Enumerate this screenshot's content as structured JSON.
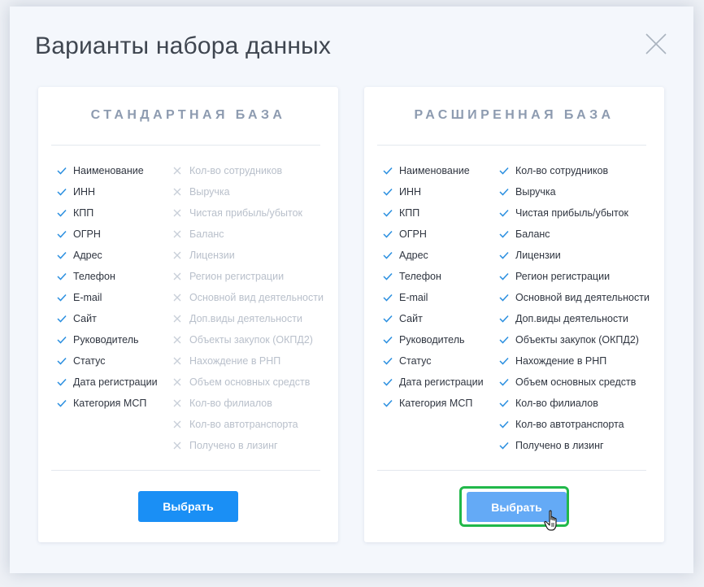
{
  "modal": {
    "title": "Варианты набора данных",
    "close_icon": "close-icon"
  },
  "cards": [
    {
      "title": "СТАНДАРТНАЯ БАЗА",
      "button_label": "Выбрать",
      "button_color": "#1a8ff5",
      "col1": [
        "Наименование",
        "ИНН",
        "КПП",
        "ОГРН",
        "Адрес",
        "Телефон",
        "E-mail",
        "Сайт",
        "Руководитель",
        "Статус",
        "Дата регистрации",
        "Категория МСП"
      ],
      "col2": [
        "Кол-во сотрудников",
        "Выручка",
        "Чистая прибыль/убыток",
        "Баланс",
        "Лицензии",
        "Регион регистрации",
        "Основной вид деятельности",
        "Доп.виды деятельности",
        "Объекты закупок (ОКПД2)",
        "Нахождение в РНП",
        "Объем основных средств",
        "Кол-во филиалов",
        "Кол-во автотранспорта",
        "Получено в лизинг"
      ],
      "col2_included": false
    },
    {
      "title": "РАСШИРЕННАЯ БАЗА",
      "button_label": "Выбрать",
      "button_color": "#64aaf6",
      "col1": [
        "Наименование",
        "ИНН",
        "КПП",
        "ОГРН",
        "Адрес",
        "Телефон",
        "E-mail",
        "Сайт",
        "Руководитель",
        "Статус",
        "Дата регистрации",
        "Категория МСП"
      ],
      "col2": [
        "Кол-во сотрудников",
        "Выручка",
        "Чистая прибыль/убыток",
        "Баланс",
        "Лицензии",
        "Регион регистрации",
        "Основной вид деятельности",
        "Доп.виды деятельности",
        "Объекты закупок (ОКПД2)",
        "Нахождение в РНП",
        "Объем основных средств",
        "Кол-во филиалов",
        "Кол-во автотранспорта",
        "Получено в лизинг"
      ],
      "col2_included": true
    }
  ],
  "colors": {
    "check": "#2a8fe0",
    "cross": "#c8cfd8",
    "highlight": "#21b84a"
  }
}
